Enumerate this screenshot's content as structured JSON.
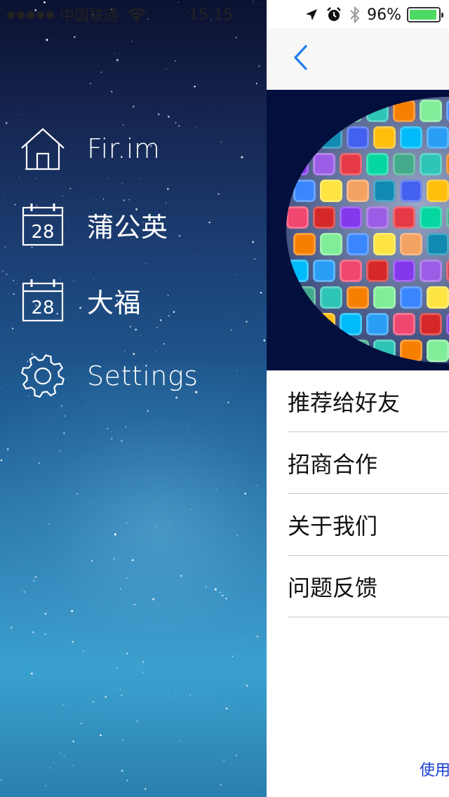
{
  "status_bar": {
    "carrier": "中国联通",
    "time": "15:15",
    "battery_percent": "96%",
    "battery_level": 0.96,
    "icons": [
      "signal-dots-icon",
      "wifi-icon",
      "location-arrow-icon",
      "alarm-icon",
      "bluetooth-icon",
      "battery-icon"
    ]
  },
  "drawer": {
    "items": [
      {
        "label": "Fir.im",
        "icon": "home-icon"
      },
      {
        "label": "蒲公英",
        "icon": "calendar-icon",
        "icon_text": "28"
      },
      {
        "label": "大福",
        "icon": "calendar-icon",
        "icon_text": "28"
      },
      {
        "label": "Settings",
        "icon": "gear-icon"
      }
    ]
  },
  "navbar": {
    "back_icon": "chevron-left-icon",
    "tint_color": "#1e7cf0"
  },
  "banner": {
    "image": "app-icon-globe"
  },
  "list": {
    "items": [
      {
        "label": "推荐给好友"
      },
      {
        "label": "招商合作"
      },
      {
        "label": "关于我们"
      },
      {
        "label": "问题反馈"
      }
    ]
  },
  "footer": {
    "link_text": "使用"
  },
  "colors": {
    "battery_green": "#4cd964",
    "link_blue": "#1a3fd0",
    "separator": "#c8c7cc"
  }
}
